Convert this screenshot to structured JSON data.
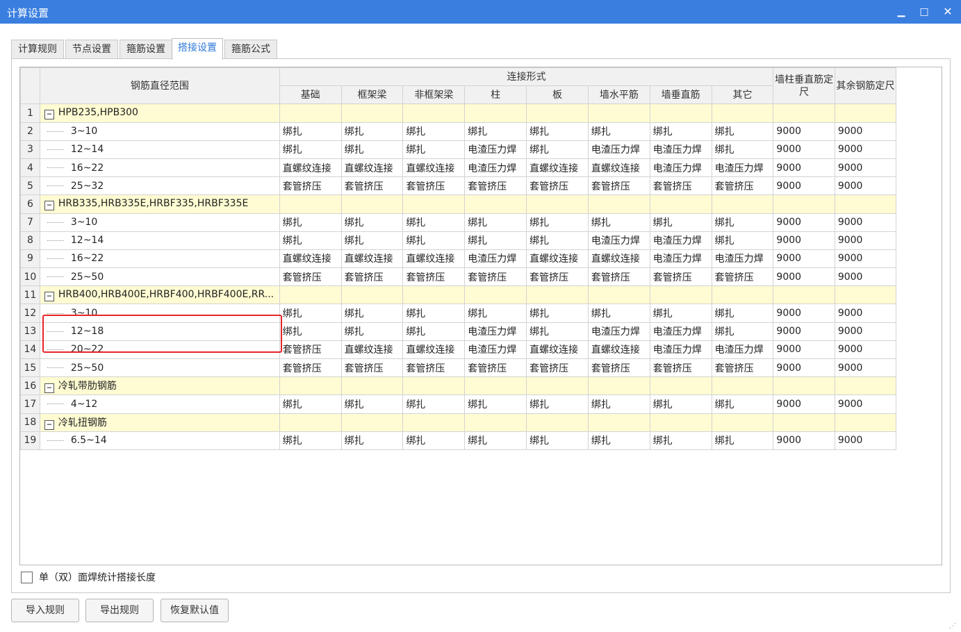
{
  "window": {
    "title": "计算设置",
    "minimize_glyph": "▁",
    "maximize_glyph": "□",
    "close_glyph": "✕"
  },
  "tabs": [
    {
      "label": "计算规则",
      "active": false
    },
    {
      "label": "节点设置",
      "active": false
    },
    {
      "label": "箍筋设置",
      "active": false
    },
    {
      "label": "搭接设置",
      "active": true
    },
    {
      "label": "箍筋公式",
      "active": false
    }
  ],
  "table": {
    "header_range": "钢筋直径范围",
    "header_group": "连接形式",
    "columns": [
      "基础",
      "框架梁",
      "非框架梁",
      "柱",
      "板",
      "墙水平筋",
      "墙垂直筋",
      "其它"
    ],
    "header_extra": [
      "墙柱垂直筋定尺",
      "其余钢筋定尺"
    ],
    "rows": [
      {
        "n": "1",
        "group": true,
        "label": "HPB235,HPB300"
      },
      {
        "n": "2",
        "label": "3~10",
        "cells": [
          "绑扎",
          "绑扎",
          "绑扎",
          "绑扎",
          "绑扎",
          "绑扎",
          "绑扎",
          "绑扎",
          "9000",
          "9000"
        ]
      },
      {
        "n": "3",
        "label": "12~14",
        "cells": [
          "绑扎",
          "绑扎",
          "绑扎",
          "电渣压力焊",
          "绑扎",
          "电渣压力焊",
          "电渣压力焊",
          "绑扎",
          "9000",
          "9000"
        ]
      },
      {
        "n": "4",
        "label": "16~22",
        "cells": [
          "直螺纹连接",
          "直螺纹连接",
          "直螺纹连接",
          "电渣压力焊",
          "直螺纹连接",
          "直螺纹连接",
          "电渣压力焊",
          "电渣压力焊",
          "9000",
          "9000"
        ]
      },
      {
        "n": "5",
        "label": "25~32",
        "cells": [
          "套管挤压",
          "套管挤压",
          "套管挤压",
          "套管挤压",
          "套管挤压",
          "套管挤压",
          "套管挤压",
          "套管挤压",
          "9000",
          "9000"
        ]
      },
      {
        "n": "6",
        "group": true,
        "label": "HRB335,HRB335E,HRBF335,HRBF335E"
      },
      {
        "n": "7",
        "label": "3~10",
        "cells": [
          "绑扎",
          "绑扎",
          "绑扎",
          "绑扎",
          "绑扎",
          "绑扎",
          "绑扎",
          "绑扎",
          "9000",
          "9000"
        ]
      },
      {
        "n": "8",
        "label": "12~14",
        "cells": [
          "绑扎",
          "绑扎",
          "绑扎",
          "绑扎",
          "绑扎",
          "电渣压力焊",
          "电渣压力焊",
          "绑扎",
          "9000",
          "9000"
        ]
      },
      {
        "n": "9",
        "label": "16~22",
        "cells": [
          "直螺纹连接",
          "直螺纹连接",
          "直螺纹连接",
          "电渣压力焊",
          "直螺纹连接",
          "直螺纹连接",
          "电渣压力焊",
          "电渣压力焊",
          "9000",
          "9000"
        ]
      },
      {
        "n": "10",
        "label": "25~50",
        "cells": [
          "套管挤压",
          "套管挤压",
          "套管挤压",
          "套管挤压",
          "套管挤压",
          "套管挤压",
          "套管挤压",
          "套管挤压",
          "9000",
          "9000"
        ]
      },
      {
        "n": "11",
        "group": true,
        "label": "HRB400,HRB400E,HRBF400,HRBF400E,RR..."
      },
      {
        "n": "12",
        "label": "3~10",
        "cells": [
          "绑扎",
          "绑扎",
          "绑扎",
          "绑扎",
          "绑扎",
          "绑扎",
          "绑扎",
          "绑扎",
          "9000",
          "9000"
        ]
      },
      {
        "n": "13",
        "label": "12~18",
        "cells": [
          "绑扎",
          "绑扎",
          "绑扎",
          "电渣压力焊",
          "绑扎",
          "电渣压力焊",
          "电渣压力焊",
          "绑扎",
          "9000",
          "9000"
        ]
      },
      {
        "n": "14",
        "label": "20~22",
        "cells": [
          "套管挤压",
          "直螺纹连接",
          "直螺纹连接",
          "电渣压力焊",
          "直螺纹连接",
          "直螺纹连接",
          "电渣压力焊",
          "电渣压力焊",
          "9000",
          "9000"
        ]
      },
      {
        "n": "15",
        "label": "25~50",
        "cells": [
          "套管挤压",
          "套管挤压",
          "套管挤压",
          "套管挤压",
          "套管挤压",
          "套管挤压",
          "套管挤压",
          "套管挤压",
          "9000",
          "9000"
        ]
      },
      {
        "n": "16",
        "group": true,
        "label": "冷轧带肋钢筋"
      },
      {
        "n": "17",
        "label": "4~12",
        "cells": [
          "绑扎",
          "绑扎",
          "绑扎",
          "绑扎",
          "绑扎",
          "绑扎",
          "绑扎",
          "绑扎",
          "9000",
          "9000"
        ]
      },
      {
        "n": "18",
        "group": true,
        "label": "冷轧扭钢筋"
      },
      {
        "n": "19",
        "label": "6.5~14",
        "cells": [
          "绑扎",
          "绑扎",
          "绑扎",
          "绑扎",
          "绑扎",
          "绑扎",
          "绑扎",
          "绑扎",
          "9000",
          "9000"
        ]
      }
    ]
  },
  "options": {
    "single_double_weld_label": "单（双）面焊统计搭接长度",
    "checked": false
  },
  "buttons": {
    "import_label": "导入规则",
    "export_label": "导出规则",
    "restore_label": "恢复默认值"
  },
  "colors": {
    "title_bar": "#3a7ee0",
    "group_row": "#fffbd2",
    "active_tab_text": "#2f7ad8",
    "highlight_box": "#e8242a"
  }
}
